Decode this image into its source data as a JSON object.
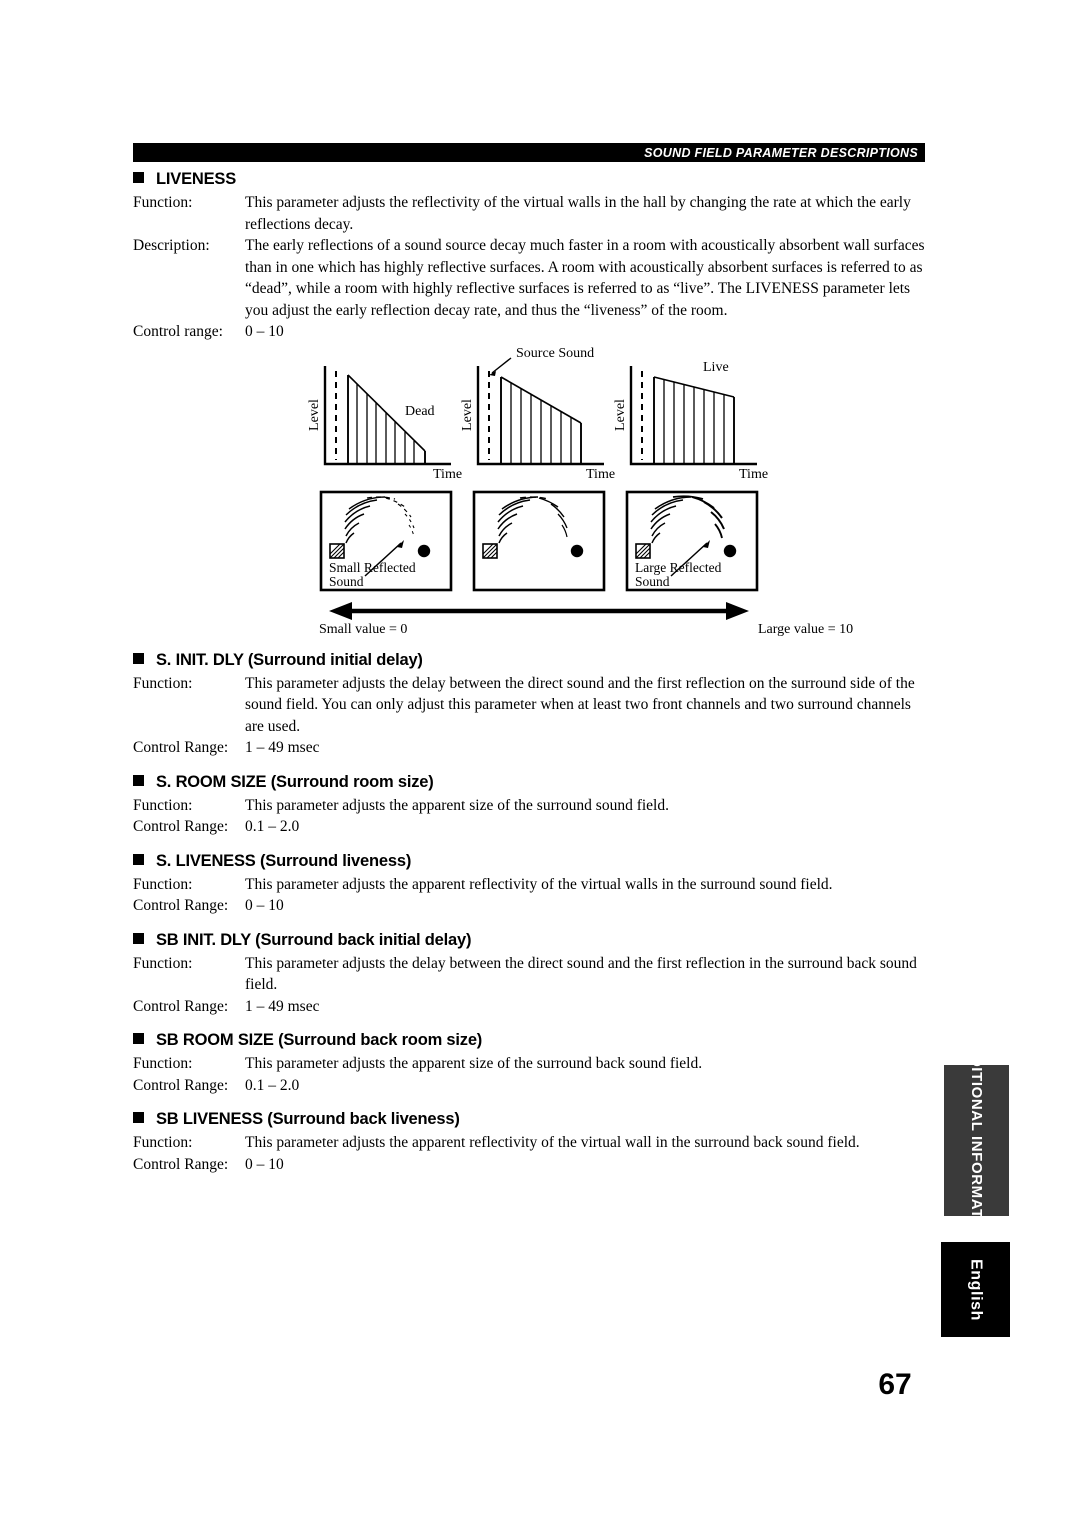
{
  "header": {
    "title": "SOUND FIELD PARAMETER DESCRIPTIONS"
  },
  "page_number": "67",
  "side_tabs": {
    "additional_information": "ADDITIONAL INFORMATION",
    "language": "English"
  },
  "labels": {
    "function": "Function:",
    "description": "Description:",
    "control_range_lower": "Control range:",
    "control_range_upper": "Control Range:"
  },
  "sections": [
    {
      "id": "liveness",
      "title": "LIVENESS",
      "function": "This parameter adjusts the reflectivity of the virtual walls in the hall by changing the rate at which the early reflections decay.",
      "description": "The early reflections of a sound source decay much faster in a room with acoustically absorbent wall surfaces than in one which has highly reflective surfaces. A room with acoustically absorbent surfaces is referred to as “dead”, while a room with highly reflective surfaces is referred to as “live”. The LIVENESS parameter lets you adjust the early reflection decay rate, and thus the “liveness” of the room.",
      "control_range_label": "Control range:",
      "control_range": "0 – 10"
    },
    {
      "id": "s-init-dly",
      "title": "S. INIT. DLY (Surround initial delay)",
      "function": "This parameter adjusts the delay between the direct sound and the first reflection on the surround side of the sound field. You can only adjust this parameter when at least two front channels and two surround channels are used.",
      "control_range_label": "Control Range:",
      "control_range": "1 – 49 msec"
    },
    {
      "id": "s-room-size",
      "title": "S. ROOM SIZE (Surround room size)",
      "function": "This parameter adjusts the apparent size of the surround sound field.",
      "control_range_label": "Control Range:",
      "control_range": "0.1 – 2.0"
    },
    {
      "id": "s-liveness",
      "title": "S. LIVENESS (Surround liveness)",
      "function": "This parameter adjusts the apparent reflectivity of the virtual walls in the surround sound field.",
      "control_range_label": "Control Range:",
      "control_range": "0 – 10"
    },
    {
      "id": "sb-init-dly",
      "title": "SB INIT. DLY (Surround back initial delay)",
      "function": "This parameter adjusts the delay between the direct sound and the first reflection in the surround back sound field.",
      "control_range_label": "Control Range:",
      "control_range": "1 – 49 msec"
    },
    {
      "id": "sb-room-size",
      "title": "SB ROOM SIZE (Surround back room size)",
      "function": "This parameter adjusts the apparent size of the surround back sound field.",
      "control_range_label": "Control Range:",
      "control_range": "0.1 – 2.0"
    },
    {
      "id": "sb-liveness",
      "title": "SB LIVENESS (Surround back liveness)",
      "function": "This parameter adjusts the apparent reflectivity of the virtual wall in the surround back sound field.",
      "control_range_label": "Control Range:",
      "control_range": "0 – 10"
    }
  ],
  "figure": {
    "axis_level": "Level",
    "axis_time": "Time",
    "graph_labels": {
      "dead": "Dead",
      "source_sound": "Source Sound",
      "live": "Live"
    },
    "room_labels": {
      "small_reflected_line1": "Small Reflected",
      "small_reflected_line2": "Sound",
      "large_reflected_line1": "Large Reflected",
      "large_reflected_line2": "Sound"
    },
    "scale": {
      "small": "Small value = 0",
      "large": "Large value = 10"
    }
  }
}
